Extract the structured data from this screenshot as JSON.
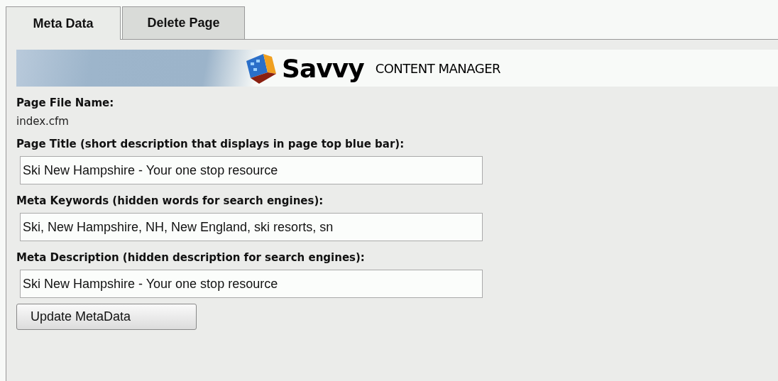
{
  "tabs": [
    {
      "label": "Meta Data",
      "selected": true
    },
    {
      "label": "Delete Page",
      "selected": false
    }
  ],
  "banner": {
    "brand": "Savvy",
    "product": "CONTENT MANAGER"
  },
  "fields": [
    {
      "kind": "static",
      "label": "Page File Name:",
      "value": "index.cfm"
    },
    {
      "kind": "input",
      "label": "Page Title (short description that displays in page top blue bar):",
      "value": "Ski New Hampshire - Your one stop resource"
    },
    {
      "kind": "input",
      "label": "Meta Keywords (hidden words for search engines):",
      "value": "Ski, New Hampshire, NH, New England, ski resorts, sn"
    },
    {
      "kind": "input",
      "label": "Meta Description (hidden description for search engines):",
      "value": "Ski New Hampshire - Your one stop resource"
    }
  ],
  "button": "Update MetaData"
}
